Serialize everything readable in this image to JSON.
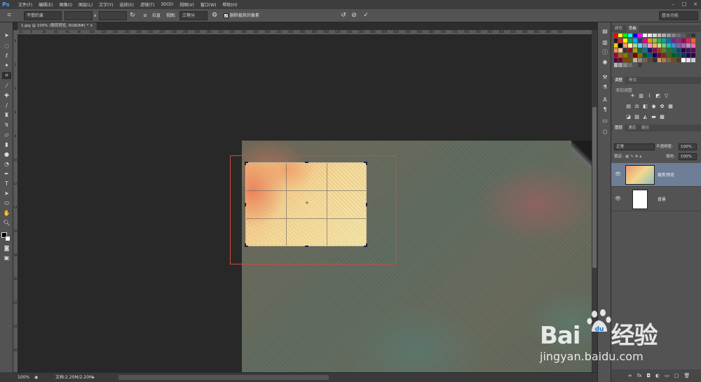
{
  "app": {
    "logo": "Ps",
    "menus": [
      "文件(F)",
      "编辑(E)",
      "图像(I)",
      "图层(L)",
      "文字(Y)",
      "选择(S)",
      "滤镜(T)",
      "3D(D)",
      "视图(V)",
      "窗口(W)",
      "帮助(H)"
    ]
  },
  "options": {
    "ratio_select": "不受约束",
    "swap_symbol": "x",
    "straighten_label": "拉直",
    "view_label": "视图:",
    "view_select": "三等分",
    "delete_pixels_label": "删除裁剪的像素",
    "workspace": "基本功能"
  },
  "document": {
    "tab_title": "1.jpg @ 100% (裁剪预览, RGB/8#) *"
  },
  "rulers": {
    "top": [
      "20",
      "0",
      "20",
      "40",
      "60",
      "80",
      "100",
      "120",
      "140",
      "160",
      "180",
      "200",
      "220",
      "240",
      "260",
      "280",
      "300",
      "320",
      "340",
      "360",
      "380",
      "400",
      "420",
      "440",
      "460",
      "480",
      "500",
      "520",
      "540",
      "560",
      "580",
      "600",
      "620",
      "640",
      "660",
      "680",
      "700",
      "720",
      "740",
      "760",
      "780",
      "800",
      "820",
      "840",
      "860",
      "880",
      "900"
    ],
    "left": [
      "0",
      "2",
      "4",
      "6",
      "8",
      "10",
      "12",
      "14",
      "16",
      "18",
      "20",
      "22",
      "24",
      "26"
    ]
  },
  "status": {
    "zoom": "100%",
    "doc_size": "文档:2.20M/2.20M"
  },
  "panels": {
    "color_tabs": [
      "颜色",
      "色板"
    ],
    "adjust_tabs": [
      "调整",
      "样式"
    ],
    "adjust_add_label": "添加调整",
    "layers_tabs": [
      "图层",
      "通道",
      "路径"
    ],
    "blend_mode": "正常",
    "opacity_label": "不透明度:",
    "opacity_value": "100%",
    "lock_label": "锁定:",
    "fill_label": "填充:",
    "fill_value": "100%",
    "layers": [
      {
        "name": "裁剪预览"
      },
      {
        "name": "背景"
      }
    ]
  },
  "watermark": {
    "logo_text": "Bai",
    "logo_text2": "经验",
    "url": "jingyan.baidu.com"
  },
  "colors": {
    "annotation": "#d9453d",
    "selected_layer": "#6d7e96"
  }
}
